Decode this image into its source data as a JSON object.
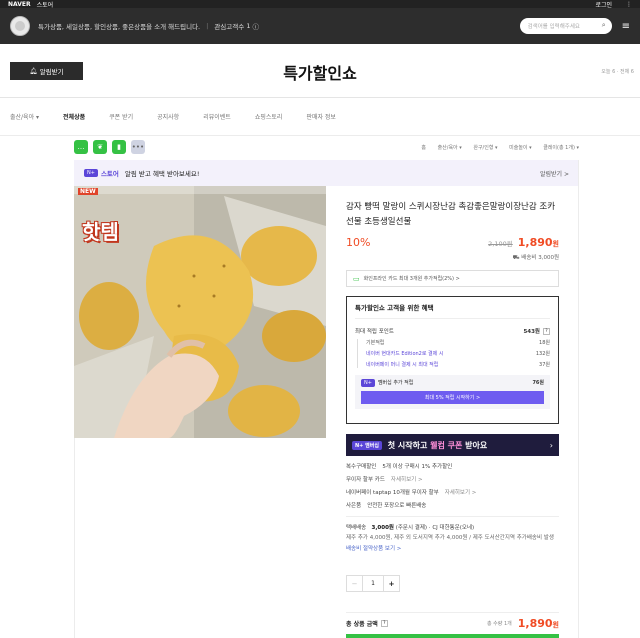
{
  "topbar": {
    "logo": "NAVER",
    "sublogo": "스토어",
    "login": "로그인",
    "menu": "⋮"
  },
  "storebar": {
    "tagline": "특가상품, 세일상품, 할인상품, 좋은상품을 소개 해드립니다.",
    "interest_label": "관심고객수",
    "interest_count": "1",
    "info_icon": "ⓘ",
    "search_placeholder": "검색어를 입력해주세요"
  },
  "header": {
    "alarm_label": "알림받기",
    "store_name": "특가할인쇼",
    "visitors": "오늘 6 · 전체 6"
  },
  "nav": {
    "items": [
      "출산/육아 ▾",
      "전체상품",
      "쿠폰 받기",
      "공지사항",
      "리뷰이벤트",
      "쇼핑스토리",
      "판매자 정보"
    ]
  },
  "toolbar": {
    "icons": [
      "talk-icon",
      "leaf-icon",
      "bookmark-icon",
      "more-icon"
    ],
    "crumbs": [
      "홈",
      "출산/육아 ▾",
      "완구/인형 ▾",
      "미술놀이 ▾",
      "클레이(총 1개) ▾"
    ]
  },
  "banner": {
    "badge": "N+",
    "storeer": "스토어",
    "message": "알림 받고 혜택 받아보세요!",
    "action": "알림받기 >"
  },
  "product": {
    "new_tag": "NEW",
    "hot_text": "핫템",
    "title": "감자 빵떡 말랑이 스퀴시장난감 촉감좋은말랑이장난감 조카선물 초등생일선물",
    "discount": "10%",
    "original_price": "2,100원",
    "price": "1,890",
    "won": "원",
    "shipping": "배송비 3,000원",
    "card_benefit": "화인프라인 카드 최대 3개원 추가적립(2%) >"
  },
  "benefit": {
    "heading": "특가할인쇼 고객을 위한 혜택",
    "max_label": "최대 적립 포인트",
    "max_value": "543원",
    "rows": [
      {
        "label": "기본적립",
        "value": "18원"
      },
      {
        "label": "네이버 현대카드 Edition2로 결제 시",
        "value": "132원"
      },
      {
        "label": "네이버페이 머니 결제 시 최대 적립",
        "value": "37원"
      }
    ],
    "member_label": "멤버십 추가 적립",
    "member_value": "76원",
    "member_button": "최대 5% 적립 시작하기 >"
  },
  "promo": {
    "badge": "N+ 멤버십",
    "text_a": "첫 시작하고",
    "text_b": "웰컴 쿠폰",
    "text_c": "받아요",
    "arrow": "›"
  },
  "details": [
    {
      "label": "복수구매할인",
      "text": "5개 이상 구매시 1% 추가할인",
      "more": ""
    },
    {
      "label": "무이자 할부 카드",
      "text": "",
      "more": "자세히보기 >"
    },
    {
      "label": "네이버페이 taptap 10개월 무이자 할부",
      "text": "",
      "more": "자세히보기 >"
    },
    {
      "label": "사은품",
      "text": "안전한 포장으로 빠른배송",
      "more": ""
    }
  ],
  "shipping_sec": {
    "label": "택배배송",
    "amount": "3,000원",
    "condition": "(주문시 결제)",
    "carrier": "CJ 대한통운(오네)",
    "note": "제주 추가 4,000원, 제주 외 도서지역 추가 4,000원 / 제주 도서산간지역 추가배송비 발생",
    "link": "배송비 절약상품 보기 >"
  },
  "quantity": {
    "minus": "−",
    "value": "1",
    "plus": "+"
  },
  "total": {
    "label": "총 상품 금액",
    "count": "총 수량 1개",
    "amount": "1,890",
    "won": "원"
  },
  "colors": {
    "accent": "#f04b24",
    "naver_green": "#35c144",
    "purple": "#5b46d8"
  }
}
